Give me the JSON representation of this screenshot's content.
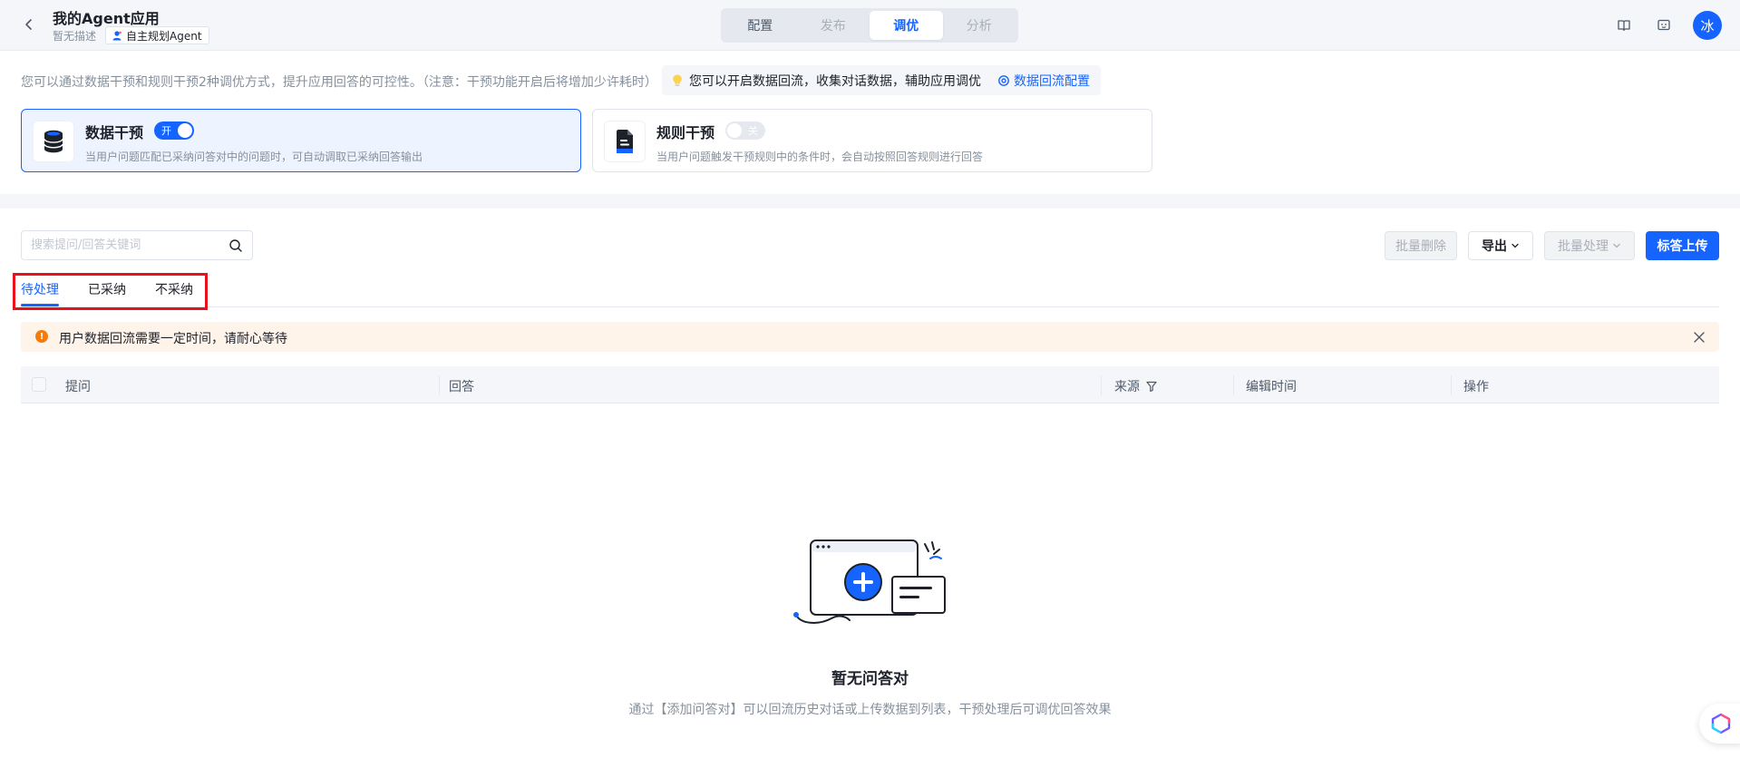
{
  "header": {
    "title": "我的Agent应用",
    "description": "暂无描述",
    "agent_type": "自主规划Agent",
    "tabs": [
      {
        "label": "配置",
        "state": "normal"
      },
      {
        "label": "发布",
        "state": "disabled"
      },
      {
        "label": "调优",
        "state": "active"
      },
      {
        "label": "分析",
        "state": "disabled"
      }
    ],
    "avatar_text": "冰",
    "icons": [
      "book-icon",
      "feedback-icon"
    ]
  },
  "intro": {
    "text": "您可以通过数据干预和规则干预2种调优方式，提升应用回答的可控性。（注意：干预功能开启后将增加少许耗时）",
    "hint_text": "您可以开启数据回流，收集对话数据，辅助应用调优",
    "hint_link": "数据回流配置"
  },
  "cards": [
    {
      "title": "数据干预",
      "desc": "当用户问题匹配已采纳问答对中的问题时，可自动调取已采纳回答输出",
      "switch_label": "开",
      "enabled": true
    },
    {
      "title": "规则干预",
      "desc": "当用户问题触发干预规则中的条件时，会自动按照回答规则进行回答",
      "switch_label": "关",
      "enabled": false
    }
  ],
  "toolbar": {
    "search_placeholder": "搜索提问/回答关键词",
    "batch_delete": "批量删除",
    "export": "导出",
    "batch_process": "批量处理",
    "upload": "标答上传"
  },
  "tabs": [
    {
      "label": "待处理",
      "active": true
    },
    {
      "label": "已采纳",
      "active": false
    },
    {
      "label": "不采纳",
      "active": false
    }
  ],
  "alert": {
    "text": "用户数据回流需要一定时间，请耐心等待"
  },
  "table": {
    "columns": [
      "提问",
      "回答",
      "来源",
      "编辑时间",
      "操作"
    ]
  },
  "empty": {
    "title": "暂无问答对",
    "description": "通过【添加问答对】可以回流历史对话或上传数据到列表，干预处理后可调优回答效果"
  },
  "colors": {
    "primary": "#1664ff",
    "alert_bg": "#fff4ea",
    "alert_icon": "#f77b0a",
    "highlight": "#e8121f"
  }
}
